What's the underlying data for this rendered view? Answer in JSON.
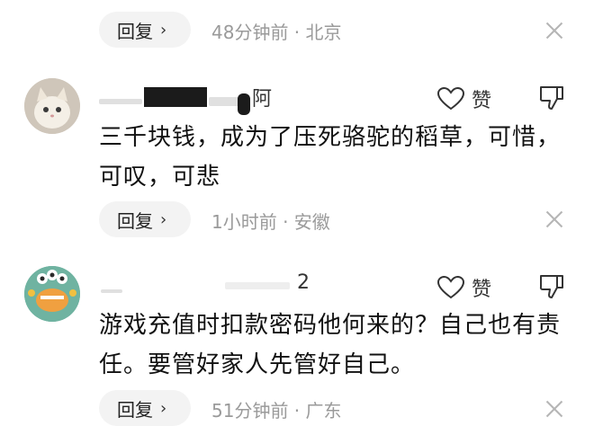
{
  "reply_label": "回复",
  "chevron": "›",
  "like_label": "赞",
  "comments": [
    {
      "meta": "48分钟前 · 北京"
    },
    {
      "username_visible": "阿",
      "content": "三千块钱，成为了压死骆驼的稻草，可惜，可叹，可悲",
      "meta": "1小时前 · 安徽",
      "avatar_icon": "kitten-avatar-icon"
    },
    {
      "username_visible": "2",
      "content": "游戏充值时扣款密码他何来的？自己也有责任。要管好家人先管好自己。",
      "meta": "51分钟前 · 广东",
      "avatar_icon": "green-monster-avatar-icon"
    }
  ],
  "colors": {
    "meta_text": "#9a9a9a",
    "reply_bg": "#f3f3f3",
    "monster_green": "#6fb3a1",
    "monster_mouth": "#f0a040"
  }
}
